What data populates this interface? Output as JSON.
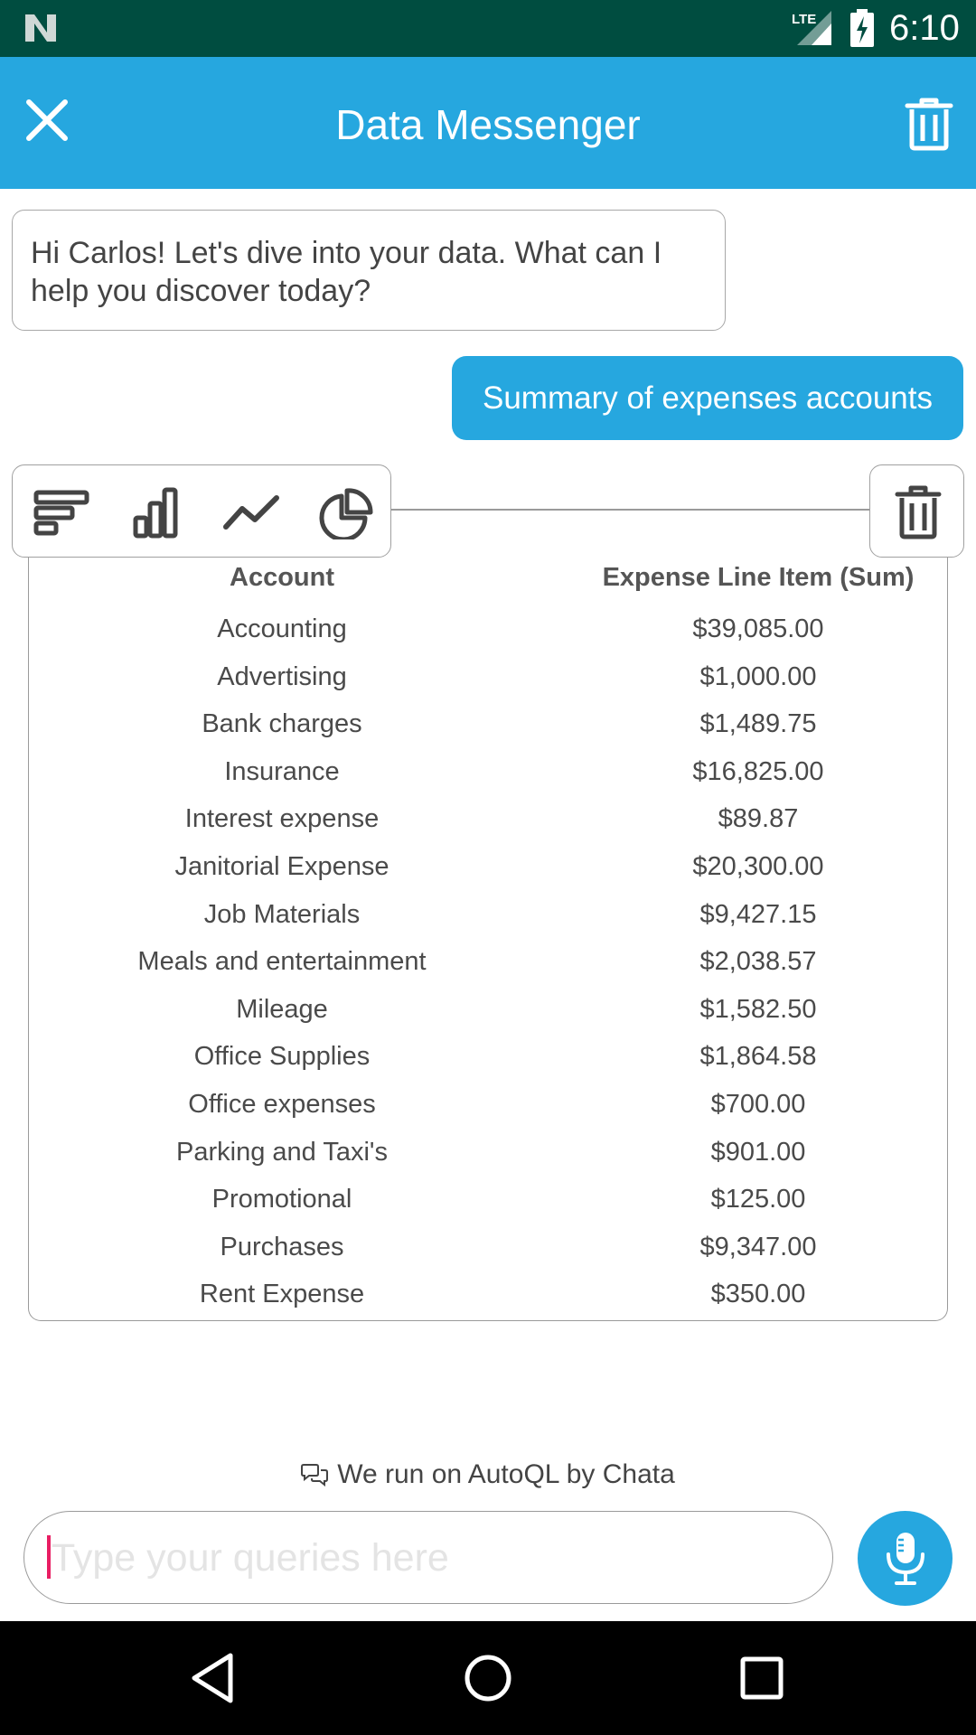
{
  "status_bar": {
    "time": "6:10",
    "network": "LTE",
    "icons": [
      "n-logo-icon",
      "signal-icon",
      "battery-charging-icon"
    ]
  },
  "app_bar": {
    "title": "Data Messenger",
    "close_icon": "close-icon",
    "clear_icon": "trash-icon"
  },
  "conversation": {
    "bot_greeting": "Hi Carlos! Let's dive into your data. What can I help you discover today?",
    "user_query": "Summary of expenses accounts",
    "viz_toolbar": [
      "bar-chart-icon",
      "column-chart-icon",
      "line-chart-icon",
      "pie-chart-icon"
    ],
    "delete_icon": "trash-icon"
  },
  "table": {
    "columns": [
      "Account",
      "Expense Line Item (Sum)"
    ],
    "rows": [
      [
        "Accounting",
        "$39,085.00"
      ],
      [
        "Advertising",
        "$1,000.00"
      ],
      [
        "Bank charges",
        "$1,489.75"
      ],
      [
        "Insurance",
        "$16,825.00"
      ],
      [
        "Interest expense",
        "$89.87"
      ],
      [
        "Janitorial Expense",
        "$20,300.00"
      ],
      [
        "Job Materials",
        "$9,427.15"
      ],
      [
        "Meals and entertainment",
        "$2,038.57"
      ],
      [
        "Mileage",
        "$1,582.50"
      ],
      [
        "Office Supplies",
        "$1,864.58"
      ],
      [
        "Office expenses",
        "$700.00"
      ],
      [
        "Parking and Taxi's",
        "$901.00"
      ],
      [
        "Promotional",
        "$125.00"
      ],
      [
        "Purchases",
        "$9,347.00"
      ],
      [
        "Rent Expense",
        "$350.00"
      ]
    ]
  },
  "footer": {
    "powered_by": "We run on AutoQL by Chata"
  },
  "input": {
    "placeholder": "Type your queries here",
    "value": ""
  },
  "nav_bar": {
    "buttons": [
      "back-icon",
      "home-icon",
      "recents-icon"
    ]
  },
  "colors": {
    "status_bar": "#004d40",
    "accent": "#26a7df",
    "caret": "#e91e63"
  }
}
